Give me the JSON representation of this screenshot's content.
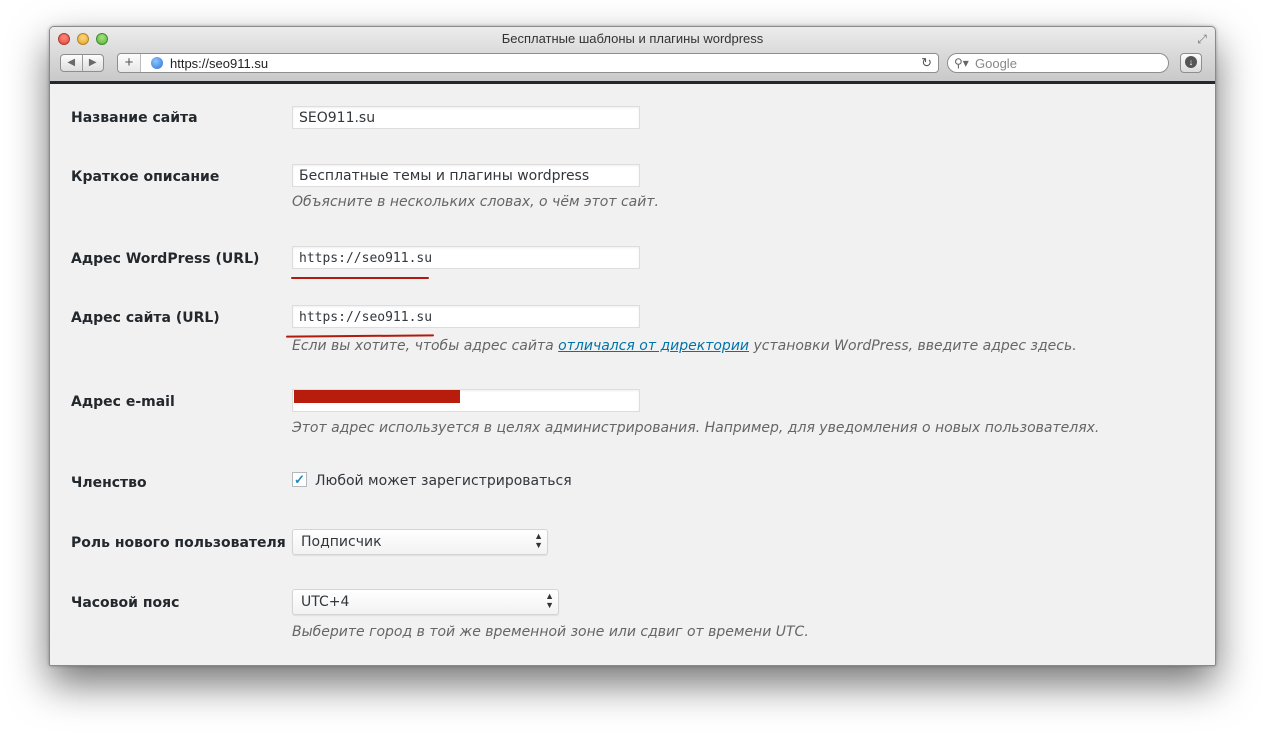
{
  "window": {
    "title": "Бесплатные шаблоны и плагины wordpress"
  },
  "toolbar": {
    "url": "https://seo911.su",
    "search_placeholder": "Google",
    "plus_label": "+",
    "back_icon": "back-arrow-icon",
    "forward_icon": "forward-arrow-icon"
  },
  "settings": {
    "site_title": {
      "label": "Название сайта",
      "value": "SEO911.su"
    },
    "tagline": {
      "label": "Краткое описание",
      "value": "Бесплатные темы и плагины wordpress",
      "description": "Объясните в нескольких словах, о чём этот сайт."
    },
    "wp_url": {
      "label": "Адрес WordPress (URL)",
      "value": "https://seo911.su"
    },
    "site_url": {
      "label": "Адрес сайта (URL)",
      "value": "https://seo911.su",
      "description_before": "Если вы хотите, чтобы адрес сайта ",
      "description_link": "отличался от директории",
      "description_after": " установки WordPress, введите адрес здесь."
    },
    "email": {
      "label": "Адрес e-mail",
      "description": "Этот адрес используется в целях администрирования. Например, для уведомления о новых пользователях."
    },
    "membership": {
      "label": "Членство",
      "checkbox_label": "Любой может зарегистрироваться",
      "checked": true
    },
    "default_role": {
      "label": "Роль нового пользователя",
      "value": "Подписчик"
    },
    "timezone": {
      "label": "Часовой пояс",
      "value": "UTC+4",
      "description": "Выберите город в той же временной зоне или сдвиг от времени UTC."
    }
  },
  "colors": {
    "annotation_red": "#b01a0f",
    "link": "#0073aa",
    "checkmark": "#1e8cbe"
  }
}
